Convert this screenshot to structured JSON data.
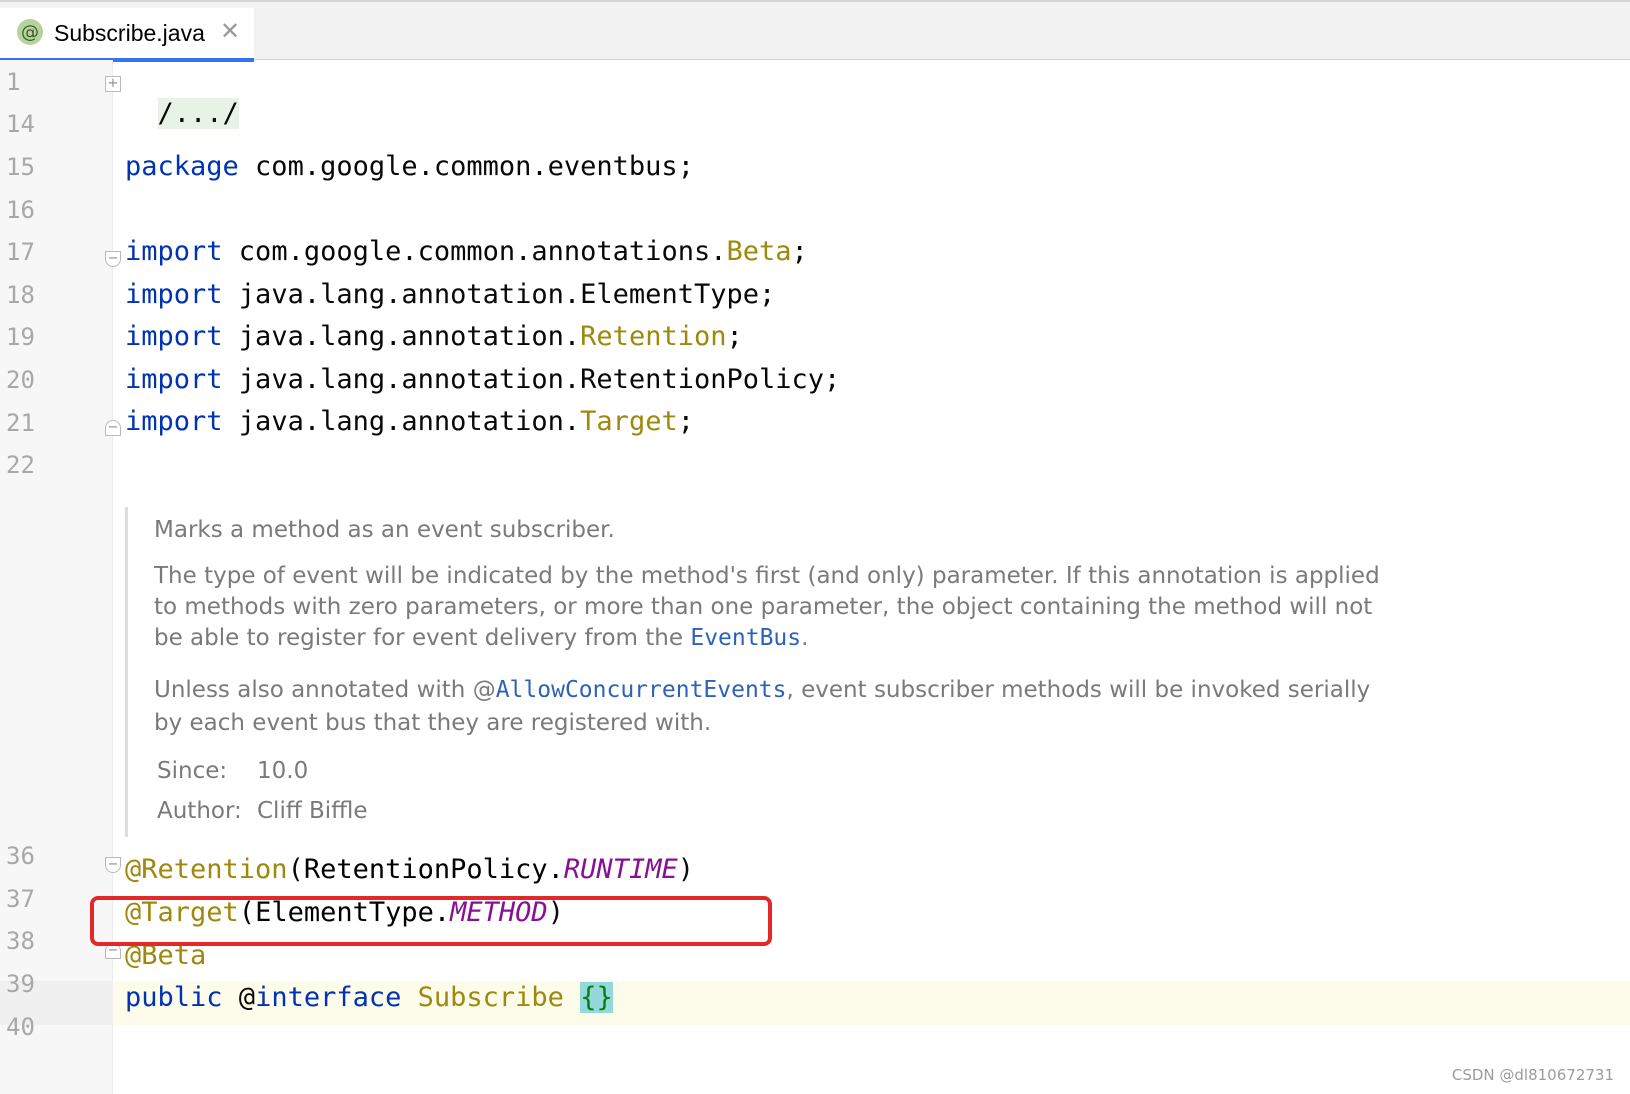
{
  "tab": {
    "icon": "@",
    "title": "Subscribe.java",
    "close": "✕"
  },
  "line_numbers": [
    "1",
    "14",
    "15",
    "16",
    "17",
    "18",
    "19",
    "20",
    "21",
    "22",
    "36",
    "37",
    "38",
    "39",
    "40"
  ],
  "code": {
    "l1": "/.../",
    "l15_kw": "package",
    "l15_rest": " com.google.common.eventbus;",
    "import_kw": "import",
    "l17_pre": " com.google.common.annotations.",
    "l17_cls": "Beta",
    "l18_pre": " java.lang.annotation.ElementType;",
    "l19_pre": " java.lang.annotation.",
    "l19_cls": "Retention",
    "l20_pre": " java.lang.annotation.RetentionPolicy;",
    "l21_pre": " java.lang.annotation.",
    "l21_cls": "Target",
    "semicolon": ";",
    "l36_ann": "@Retention",
    "l36_paren_open": "(",
    "l36_type": "RetentionPolicy.",
    "l36_enum": "RUNTIME",
    "l36_paren_close": ")",
    "l37_ann": "@Target",
    "l37_paren_open": "(",
    "l37_type": "ElementType.",
    "l37_enum": "METHOD",
    "l37_paren_close": ")",
    "l38_ann": "@Beta",
    "l39_public": "public",
    "l39_at": " @",
    "l39_interface": "interface",
    "l39_name": " Subscribe ",
    "l39_braces": "{}"
  },
  "javadoc": {
    "p1": "Marks a method as an event subscriber.",
    "p2_l1": "The type of event will be indicated by the method's first (and only) parameter. If this annotation is applied",
    "p2_l2": "to methods with zero parameters, or more than one parameter, the object containing the method will not",
    "p2_l3_pre": "be able to register for event delivery from the ",
    "p2_l3_link": "EventBus",
    "p2_l3_post": ".",
    "p3_l1_pre": "Unless also annotated with @",
    "p3_l1_link": "AllowConcurrentEvents",
    "p3_l1_post": ", event subscriber methods will be invoked serially",
    "p3_l2": "by each event bus that they are registered with.",
    "since_label": "Since:",
    "since_value": "10.0",
    "author_label": "Author:",
    "author_value": "Cliff Biffle"
  },
  "colors": {
    "keyword": "#0033b3",
    "annotation": "#9e880d",
    "enum_constant": "#871094",
    "link": "#2d62b6",
    "highlight_box": "#e3282a"
  },
  "watermark": "CSDN @dl810672731"
}
